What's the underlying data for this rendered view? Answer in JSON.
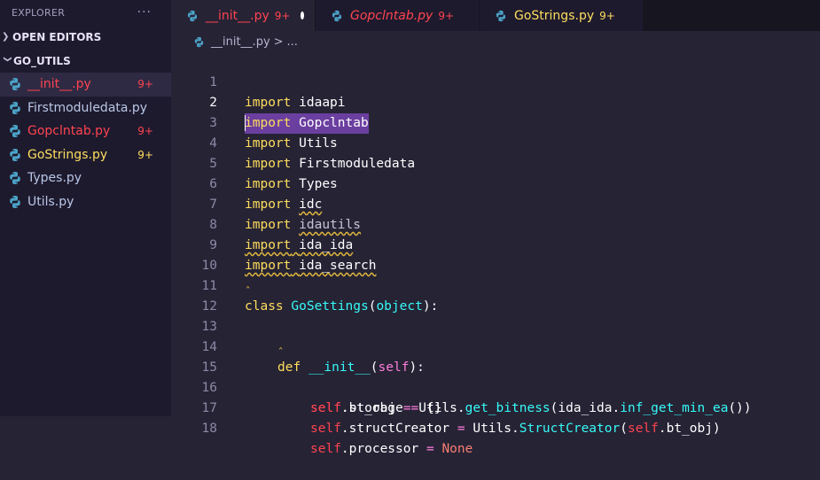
{
  "sidebar": {
    "title": "EXPLORER",
    "more": "···",
    "open_editors": "OPEN EDITORS",
    "folder": "GO_UTILS",
    "files": [
      {
        "name": "__init__.py",
        "badge": "9+"
      },
      {
        "name": "Firstmoduledata.py",
        "badge": ""
      },
      {
        "name": "Gopclntab.py",
        "badge": "9+"
      },
      {
        "name": "GoStrings.py",
        "badge": "9+"
      },
      {
        "name": "Types.py",
        "badge": ""
      },
      {
        "name": "Utils.py",
        "badge": ""
      }
    ]
  },
  "tabs": [
    {
      "label": "__init__.py",
      "badge": "9+"
    },
    {
      "label": "Gopclntab.py",
      "badge": "9+"
    },
    {
      "label": "GoStrings.py",
      "badge": "9+"
    }
  ],
  "breadcrumb": {
    "file": "__init__.py",
    "sep": ">",
    "rest": "..."
  },
  "editor": {
    "line_numbers": [
      "1",
      "2",
      "3",
      "4",
      "5",
      "6",
      "7",
      "8",
      "9",
      "10",
      "11",
      "12",
      "13",
      "14",
      "15",
      "16",
      "17",
      "18"
    ],
    "lines": {
      "l1": {
        "kw": "import",
        "mod": "idaapi"
      },
      "l2": {
        "kw": "import",
        "mod": "Gopclntab"
      },
      "l3": {
        "kw": "import",
        "mod": "Utils"
      },
      "l4": {
        "kw": "import",
        "mod": "Firstmoduledata"
      },
      "l5": {
        "kw": "import",
        "mod": "Types"
      },
      "l6": {
        "kw": "import",
        "mod": "idc"
      },
      "l7": {
        "kw": "import",
        "mod": "idautils"
      },
      "l8": {
        "kw": "import",
        "mod": "ida_ida"
      },
      "l9": {
        "kw": "import",
        "mod": "ida_search"
      },
      "l11": {
        "kw": "class",
        "name": "GoSettings",
        "open": "(",
        "base": "object",
        "close": "):"
      },
      "l14": {
        "kw": "def",
        "name": "__init__",
        "open": "(",
        "param": "self",
        "close": "):"
      },
      "l15": {
        "self": "self",
        "attr": ".storage",
        "eq": " = ",
        "val": "{}"
      },
      "l16": {
        "self": "self",
        "attr": ".bt_obj",
        "eq": " = ",
        "obj": "Utils.",
        "fn": "get_bitness",
        "p1": "(",
        "arg": "ida_ida.",
        "fn2": "inf_get_min_ea",
        "p2": "())"
      },
      "l17": {
        "self": "self",
        "attr": ".structCreator",
        "eq": " = ",
        "obj": "Utils.",
        "fn": "StructCreator",
        "p1": "(",
        "self2": "self",
        "attr2": ".bt_obj",
        "p2": ")"
      },
      "l18": {
        "self": "self",
        "attr": ".processor",
        "eq": " = ",
        "val": "None"
      }
    }
  }
}
